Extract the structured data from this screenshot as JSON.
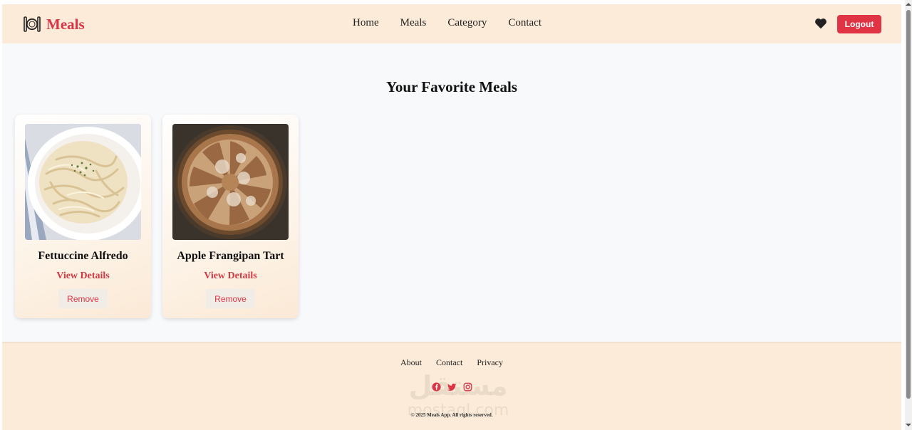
{
  "navbar": {
    "brand": "Meals",
    "links": [
      "Home",
      "Meals",
      "Category",
      "Contact"
    ],
    "logout_label": "Logout"
  },
  "main": {
    "title": "Your Favorite Meals",
    "cards": [
      {
        "title": "Fettuccine Alfredo",
        "view_label": "View Details",
        "remove_label": "Remove"
      },
      {
        "title": "Apple Frangipan Tart",
        "view_label": "View Details",
        "remove_label": "Remove"
      }
    ]
  },
  "footer": {
    "links": [
      "About",
      "Contact",
      "Privacy"
    ],
    "copyright": "© 2025 Meals App. All rights reserved.",
    "watermark_ar": "مستقل",
    "watermark_en": "mostaql.com"
  },
  "colors": {
    "accent": "#dc3545",
    "nav_bg": "#fcebd8",
    "page_bg": "#f8f9fb"
  },
  "icons": {
    "brand": "plate-cutlery-icon",
    "favorites": "heart-icon",
    "socials": [
      "facebook-icon",
      "twitter-icon",
      "instagram-icon"
    ]
  }
}
